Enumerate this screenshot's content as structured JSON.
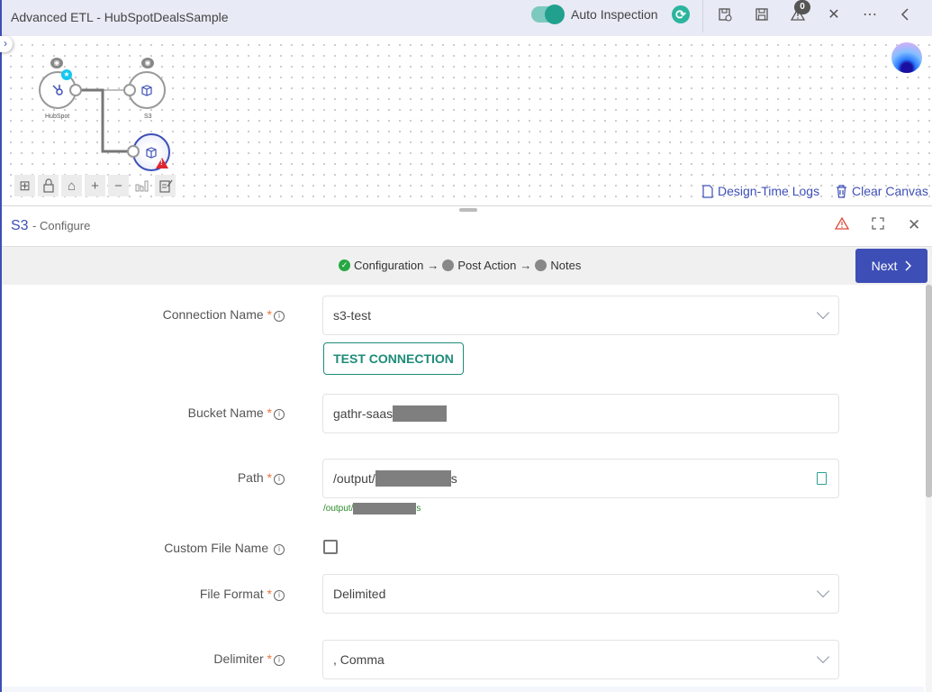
{
  "header": {
    "title": "Advanced ETL - HubSpotDealsSample",
    "auto_inspection_label": "Auto Inspection",
    "auto_inspection_on": true,
    "warnings_count": "0",
    "icons": [
      "save-as-icon",
      "save-icon",
      "warning-icon",
      "close-icon",
      "more-icon",
      "collapse-left-icon"
    ]
  },
  "canvas": {
    "nodes": [
      {
        "label": "HubSpot",
        "icon": "hubspot-icon"
      },
      {
        "label": "S3",
        "icon": "cube-icon"
      },
      {
        "label": "",
        "icon": "cube-icon",
        "selected": true,
        "has_error": true
      }
    ],
    "tools": [
      "grid-icon",
      "lock-icon",
      "home-icon",
      "zoom-in-icon",
      "zoom-out-icon",
      "chart-icon",
      "notes-icon"
    ],
    "design_time_logs": "Design-Time Logs",
    "clear_canvas": "Clear Canvas"
  },
  "panel": {
    "title": "S3",
    "subtitle": "- Configure",
    "steps": [
      "Configuration",
      "Post Action",
      "Notes"
    ],
    "step_arrow": "→",
    "next_label": "Next"
  },
  "form": {
    "connection_name": {
      "label": "Connection Name",
      "value": "s3-test",
      "required": true
    },
    "test_connection": "TEST CONNECTION",
    "bucket_name": {
      "label": "Bucket Name",
      "value": "gathr-saas",
      "required": true
    },
    "path": {
      "label": "Path",
      "value_prefix": "/output/",
      "value_suffix": "s",
      "hint_prefix": "/output/",
      "hint_suffix": "s",
      "required": true
    },
    "custom_file_name": {
      "label": "Custom File Name",
      "checked": false
    },
    "file_format": {
      "label": "File Format",
      "value": "Delimited",
      "required": true
    },
    "delimiter": {
      "label": "Delimiter",
      "value": ", Comma",
      "required": true
    },
    "required_mark": "*",
    "info_glyph": "i"
  },
  "colors": {
    "accent": "#3d4fb6",
    "teal": "#21a08e",
    "error": "#e0252f",
    "required": "#f0733c"
  }
}
